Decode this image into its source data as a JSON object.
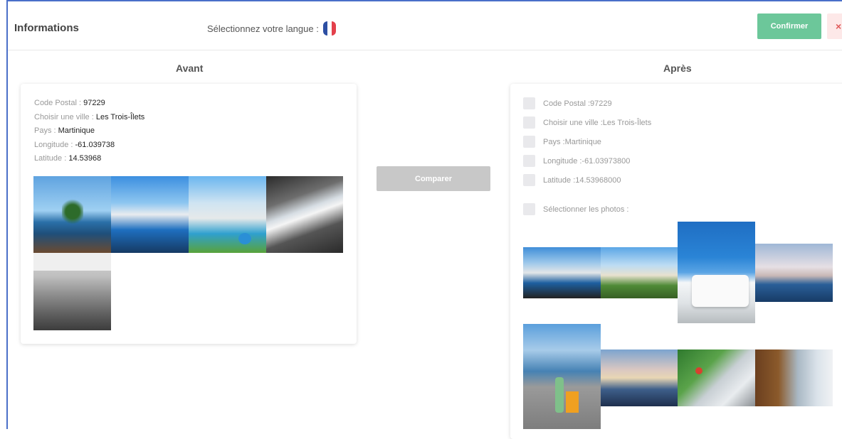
{
  "header": {
    "title": "Informations",
    "language_label": "Sélectionnez votre langue :",
    "flag_colors": [
      "#2d4fa3",
      "#ffffff",
      "#e3404b"
    ],
    "confirm_label": "Confirmer",
    "close_label": "×"
  },
  "before": {
    "title": "Avant",
    "fields": [
      {
        "label": "Code Postal : ",
        "value": "97229"
      },
      {
        "label": "Choisir une ville : ",
        "value": "Les Trois-Îlets"
      },
      {
        "label": "Pays : ",
        "value": "Martinique"
      },
      {
        "label": "Longitude : ",
        "value": "-61.039738"
      },
      {
        "label": "Latitude : ",
        "value": "14.53968"
      }
    ]
  },
  "compare_label": "Comparer",
  "after": {
    "title": "Après",
    "fields": [
      "Code Postal :97229",
      "Choisir une ville :Les Trois-Îlets",
      "Pays :Martinique",
      "Longitude :-61.03973800",
      "Latitude :14.53968000"
    ],
    "select_photos_label": "Sélectionner les photos :"
  },
  "colors": {
    "accent_border": "#4a6fc9",
    "confirm_bg": "#6cc79a",
    "close_bg": "#fde8e8",
    "compare_bg": "#c8c8c8"
  }
}
